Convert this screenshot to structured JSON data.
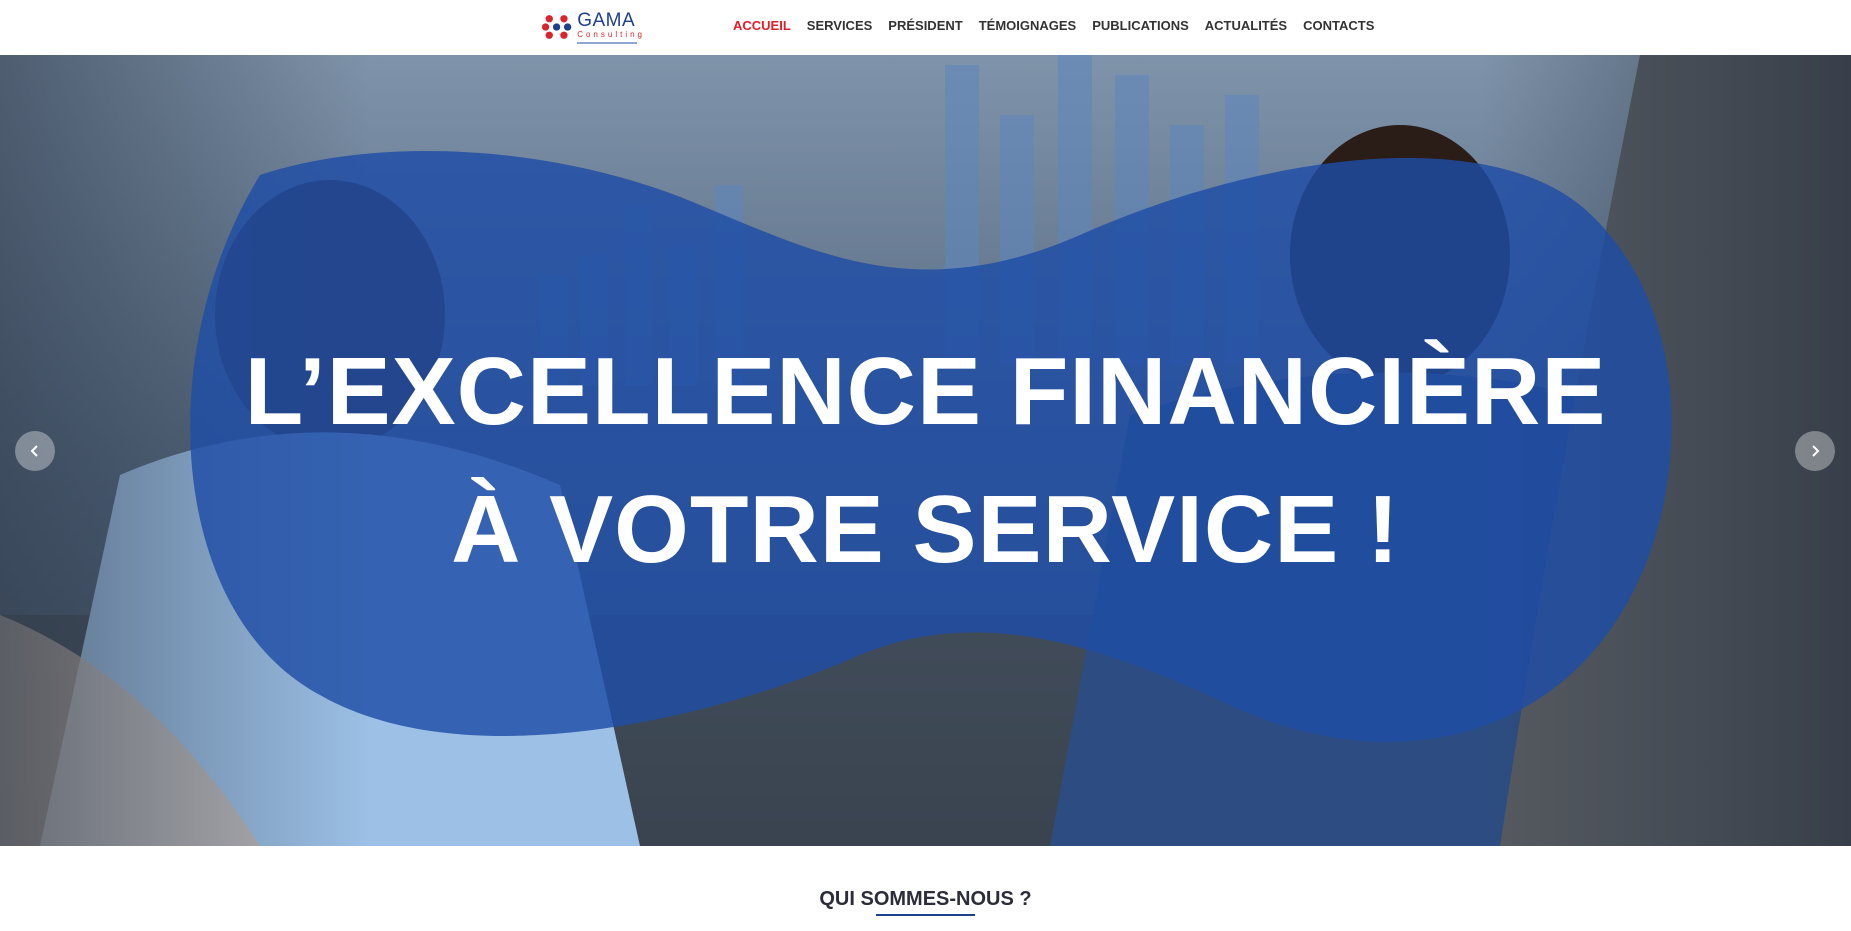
{
  "header": {
    "logo": {
      "brand": "GAMA",
      "sub": "Consulting"
    },
    "nav": [
      {
        "label": "ACCUEIL",
        "active": true
      },
      {
        "label": "SERVICES",
        "active": false
      },
      {
        "label": "PRÉSIDENT",
        "active": false
      },
      {
        "label": "TÉMOIGNAGES",
        "active": false
      },
      {
        "label": "PUBLICATIONS",
        "active": false
      },
      {
        "label": "ACTUALITÉS",
        "active": false
      },
      {
        "label": "CONTACTS",
        "active": false
      }
    ]
  },
  "hero": {
    "title_line1": "L’EXCELLENCE FINANCIÈRE",
    "title_line2": "À VOTRE SERVICE !",
    "prev_icon": "chevron-left-icon",
    "next_icon": "chevron-right-icon",
    "overlay_color": "#1e4da6"
  },
  "about": {
    "title": "QUI SOMMES-NOUS ?"
  },
  "colors": {
    "accent": "#e21e26",
    "brand_blue": "#1f3f8f",
    "nav_text": "#333333"
  }
}
